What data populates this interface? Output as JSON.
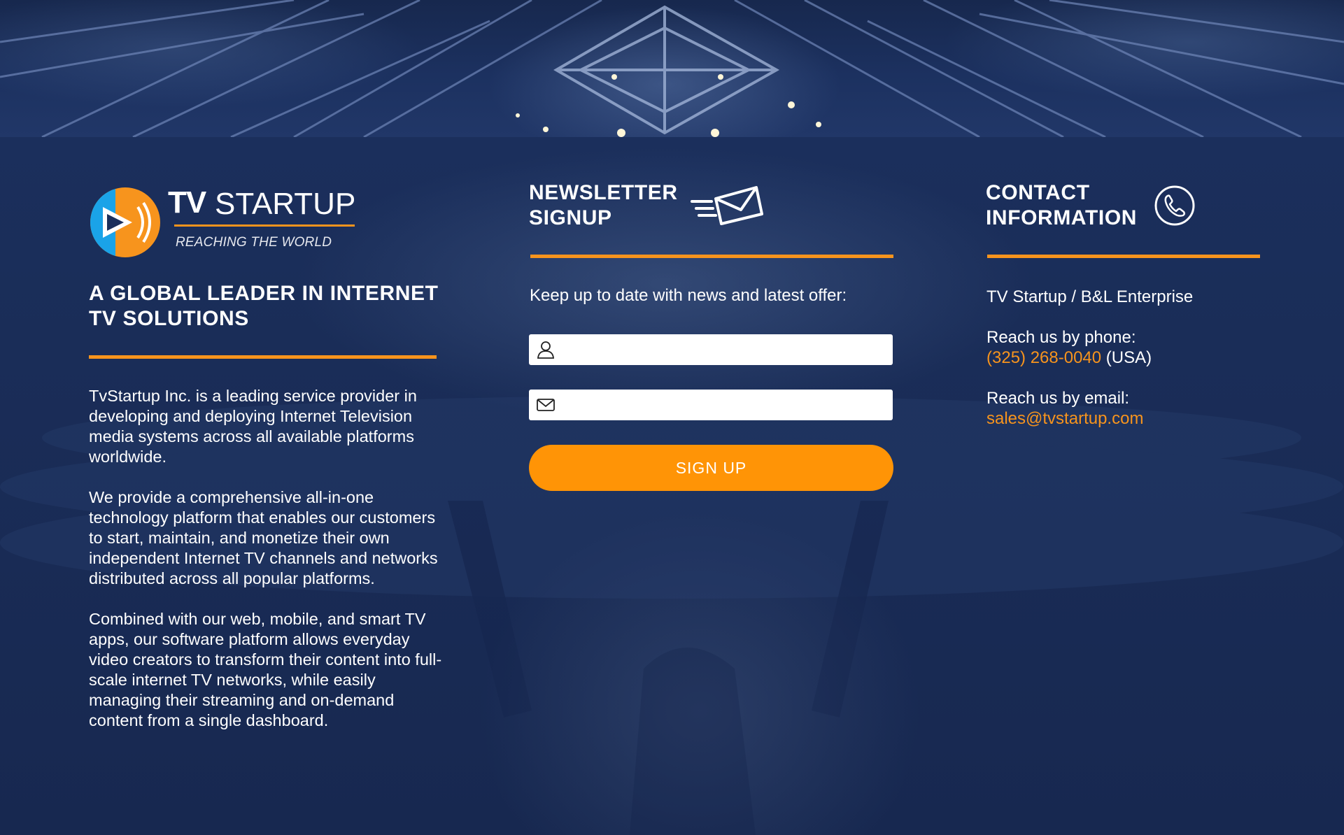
{
  "brand": {
    "name_bold": "TV",
    "name_light": "STARTUP",
    "tagline": "REACHING THE WORLD",
    "colors": {
      "accent": "#f7941d",
      "button": "#ff9406",
      "panel": "#1a2d58",
      "logo_blue": "#1aa3e8",
      "logo_orange": "#f7941d"
    }
  },
  "about": {
    "title": "A GLOBAL LEADER IN INTERNET TV SOLUTIONS",
    "paragraphs": [
      "TvStartup Inc. is a leading service provider in developing and deploying Internet Television media systems across all available platforms worldwide.",
      "We provide a comprehensive all-in-one technology platform that enables our customers to start, maintain, and monetize their own independent Internet TV channels and networks distributed across all popular platforms.",
      "Combined with our web, mobile, and smart TV apps, our software platform allows everyday video creators to transform their content into full-scale internet TV networks, while easily managing their streaming and on-demand content from a single dashboard."
    ]
  },
  "newsletter": {
    "title_line1": "NEWSLETTER",
    "title_line2": "SIGNUP",
    "icon": "flying-envelope-icon",
    "subtitle": "Keep up to date with news and latest offer:",
    "name_field": {
      "icon": "user-icon",
      "value": "",
      "placeholder": ""
    },
    "email_field": {
      "icon": "envelope-icon",
      "value": "",
      "placeholder": ""
    },
    "button_label": "SIGN UP"
  },
  "contact": {
    "title_line1": "CONTACT",
    "title_line2": "INFORMATION",
    "icon": "phone-icon",
    "company": "TV Startup / B&L Enterprise",
    "phone_label": "Reach us by phone:",
    "phone_number": "(325) 268-0040",
    "phone_suffix": "(USA)",
    "email_label": "Reach us by email:",
    "email": "sales@tvstartup.com"
  }
}
